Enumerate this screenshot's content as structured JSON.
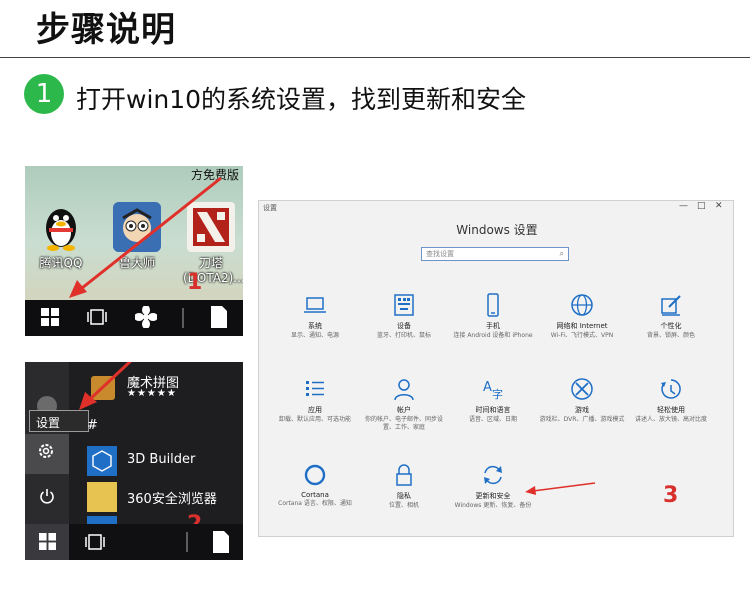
{
  "title": "步骤说明",
  "step": {
    "number": "1",
    "text": "打开win10的系统设置，找到更新和安全"
  },
  "colors": {
    "step_green": "#2db84c",
    "marker_red": "#d8302c",
    "settings_blue": "#1f6fc7"
  },
  "desktop": {
    "corner_text": "方免费版",
    "icons": [
      {
        "label": "腾讯QQ",
        "icon": "qq-penguin-icon"
      },
      {
        "label": "鲁大师",
        "icon": "ludashi-icon"
      },
      {
        "label": "刀塔",
        "icon": "dota-icon"
      }
    ],
    "dota_sub_label": "(DOTA2)...",
    "marker": "1"
  },
  "start_menu": {
    "tooltip": "设置",
    "app_title": "魔术拼图",
    "app_rating": "★★★★★",
    "section_header": "#",
    "apps": [
      {
        "label": "3D Builder",
        "tile_color": "#1f6fc7"
      },
      {
        "label": "360安全浏览器",
        "tile_color": "#e7c451"
      }
    ],
    "marker": "2"
  },
  "settings": {
    "window_title": "设置",
    "heading": "Windows 设置",
    "search_placeholder": "查找设置",
    "categories": [
      {
        "name": "系统",
        "desc": "显示、通知、电源",
        "icon": "laptop-icon"
      },
      {
        "name": "设备",
        "desc": "蓝牙、打印机、鼠标",
        "icon": "keyboard-icon"
      },
      {
        "name": "手机",
        "desc": "连接 Android 设备和 iPhone",
        "icon": "phone-icon"
      },
      {
        "name": "网络和 Internet",
        "desc": "Wi-Fi、飞行模式、VPN",
        "icon": "globe-icon"
      },
      {
        "name": "个性化",
        "desc": "背景、锁屏、颜色",
        "icon": "paint-icon"
      },
      {
        "name": "应用",
        "desc": "卸载、默认应用、可选功能",
        "icon": "apps-list-icon"
      },
      {
        "name": "帐户",
        "desc": "你的帐户、电子邮件、同步设置、工作、家庭",
        "icon": "person-icon"
      },
      {
        "name": "时间和语言",
        "desc": "语音、区域、日期",
        "icon": "language-icon"
      },
      {
        "name": "游戏",
        "desc": "游戏栏、DVR、广播、游戏模式",
        "icon": "xbox-icon"
      },
      {
        "name": "轻松使用",
        "desc": "讲述人、放大镜、高对比度",
        "icon": "ease-of-access-icon"
      },
      {
        "name": "Cortana",
        "desc": "Cortana 语言、权限、通知",
        "icon": "cortana-icon"
      },
      {
        "name": "隐私",
        "desc": "位置、相机",
        "icon": "lock-icon"
      },
      {
        "name": "更新和安全",
        "desc": "Windows 更新、恢复、备份",
        "icon": "sync-icon"
      }
    ],
    "marker": "3"
  }
}
